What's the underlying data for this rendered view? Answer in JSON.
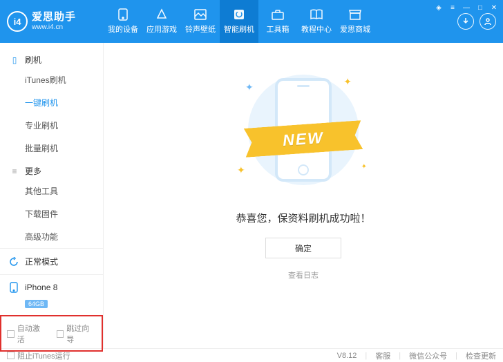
{
  "brand": {
    "logo_text": "i4",
    "title": "爱思助手",
    "url": "www.i4.cn"
  },
  "nav": [
    {
      "key": "device",
      "label": "我的设备"
    },
    {
      "key": "apps",
      "label": "应用游戏"
    },
    {
      "key": "ringtones",
      "label": "铃声壁纸"
    },
    {
      "key": "flash",
      "label": "智能刷机"
    },
    {
      "key": "toolbox",
      "label": "工具箱"
    },
    {
      "key": "tutorial",
      "label": "教程中心"
    },
    {
      "key": "store",
      "label": "爱思商城"
    }
  ],
  "sidebar": {
    "section_flash": "刷机",
    "section_more": "更多",
    "flash_items": [
      {
        "key": "itunes",
        "label": "iTunes刷机"
      },
      {
        "key": "oneclick",
        "label": "一键刷机"
      },
      {
        "key": "pro",
        "label": "专业刷机"
      },
      {
        "key": "batch",
        "label": "批量刷机"
      }
    ],
    "more_items": [
      {
        "key": "other",
        "label": "其他工具"
      },
      {
        "key": "download",
        "label": "下载固件"
      },
      {
        "key": "advanced",
        "label": "高级功能"
      }
    ],
    "mode_label": "正常模式",
    "device_name": "iPhone 8",
    "device_storage": "64GB",
    "auto_activate": "自动激活",
    "skip_guide": "跳过向导"
  },
  "main": {
    "ribbon": "NEW",
    "success": "恭喜您，保资料刷机成功啦！",
    "ok": "确定",
    "view_log": "查看日志"
  },
  "footer": {
    "block_itunes": "阻止iTunes运行",
    "version": "V8.12",
    "support": "客服",
    "wechat": "微信公众号",
    "update": "检查更新"
  }
}
